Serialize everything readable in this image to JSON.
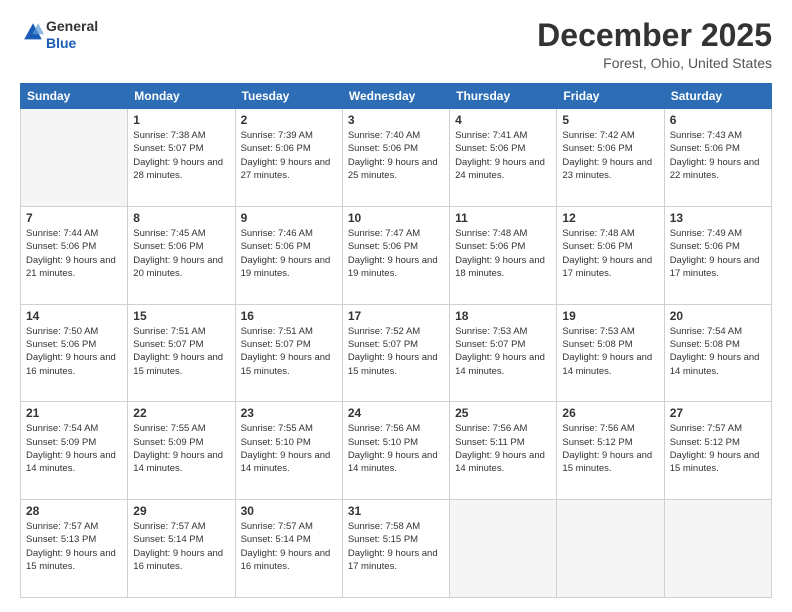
{
  "header": {
    "logo_general": "General",
    "logo_blue": "Blue",
    "month_title": "December 2025",
    "location": "Forest, Ohio, United States"
  },
  "weekdays": [
    "Sunday",
    "Monday",
    "Tuesday",
    "Wednesday",
    "Thursday",
    "Friday",
    "Saturday"
  ],
  "weeks": [
    [
      {
        "day": "",
        "empty": true
      },
      {
        "day": "1",
        "sunrise": "7:38 AM",
        "sunset": "5:07 PM",
        "daylight": "9 hours and 28 minutes."
      },
      {
        "day": "2",
        "sunrise": "7:39 AM",
        "sunset": "5:06 PM",
        "daylight": "9 hours and 27 minutes."
      },
      {
        "day": "3",
        "sunrise": "7:40 AM",
        "sunset": "5:06 PM",
        "daylight": "9 hours and 25 minutes."
      },
      {
        "day": "4",
        "sunrise": "7:41 AM",
        "sunset": "5:06 PM",
        "daylight": "9 hours and 24 minutes."
      },
      {
        "day": "5",
        "sunrise": "7:42 AM",
        "sunset": "5:06 PM",
        "daylight": "9 hours and 23 minutes."
      },
      {
        "day": "6",
        "sunrise": "7:43 AM",
        "sunset": "5:06 PM",
        "daylight": "9 hours and 22 minutes."
      }
    ],
    [
      {
        "day": "7",
        "sunrise": "7:44 AM",
        "sunset": "5:06 PM",
        "daylight": "9 hours and 21 minutes."
      },
      {
        "day": "8",
        "sunrise": "7:45 AM",
        "sunset": "5:06 PM",
        "daylight": "9 hours and 20 minutes."
      },
      {
        "day": "9",
        "sunrise": "7:46 AM",
        "sunset": "5:06 PM",
        "daylight": "9 hours and 19 minutes."
      },
      {
        "day": "10",
        "sunrise": "7:47 AM",
        "sunset": "5:06 PM",
        "daylight": "9 hours and 19 minutes."
      },
      {
        "day": "11",
        "sunrise": "7:48 AM",
        "sunset": "5:06 PM",
        "daylight": "9 hours and 18 minutes."
      },
      {
        "day": "12",
        "sunrise": "7:48 AM",
        "sunset": "5:06 PM",
        "daylight": "9 hours and 17 minutes."
      },
      {
        "day": "13",
        "sunrise": "7:49 AM",
        "sunset": "5:06 PM",
        "daylight": "9 hours and 17 minutes."
      }
    ],
    [
      {
        "day": "14",
        "sunrise": "7:50 AM",
        "sunset": "5:06 PM",
        "daylight": "9 hours and 16 minutes."
      },
      {
        "day": "15",
        "sunrise": "7:51 AM",
        "sunset": "5:07 PM",
        "daylight": "9 hours and 15 minutes."
      },
      {
        "day": "16",
        "sunrise": "7:51 AM",
        "sunset": "5:07 PM",
        "daylight": "9 hours and 15 minutes."
      },
      {
        "day": "17",
        "sunrise": "7:52 AM",
        "sunset": "5:07 PM",
        "daylight": "9 hours and 15 minutes."
      },
      {
        "day": "18",
        "sunrise": "7:53 AM",
        "sunset": "5:07 PM",
        "daylight": "9 hours and 14 minutes."
      },
      {
        "day": "19",
        "sunrise": "7:53 AM",
        "sunset": "5:08 PM",
        "daylight": "9 hours and 14 minutes."
      },
      {
        "day": "20",
        "sunrise": "7:54 AM",
        "sunset": "5:08 PM",
        "daylight": "9 hours and 14 minutes."
      }
    ],
    [
      {
        "day": "21",
        "sunrise": "7:54 AM",
        "sunset": "5:09 PM",
        "daylight": "9 hours and 14 minutes."
      },
      {
        "day": "22",
        "sunrise": "7:55 AM",
        "sunset": "5:09 PM",
        "daylight": "9 hours and 14 minutes."
      },
      {
        "day": "23",
        "sunrise": "7:55 AM",
        "sunset": "5:10 PM",
        "daylight": "9 hours and 14 minutes."
      },
      {
        "day": "24",
        "sunrise": "7:56 AM",
        "sunset": "5:10 PM",
        "daylight": "9 hours and 14 minutes."
      },
      {
        "day": "25",
        "sunrise": "7:56 AM",
        "sunset": "5:11 PM",
        "daylight": "9 hours and 14 minutes."
      },
      {
        "day": "26",
        "sunrise": "7:56 AM",
        "sunset": "5:12 PM",
        "daylight": "9 hours and 15 minutes."
      },
      {
        "day": "27",
        "sunrise": "7:57 AM",
        "sunset": "5:12 PM",
        "daylight": "9 hours and 15 minutes."
      }
    ],
    [
      {
        "day": "28",
        "sunrise": "7:57 AM",
        "sunset": "5:13 PM",
        "daylight": "9 hours and 15 minutes."
      },
      {
        "day": "29",
        "sunrise": "7:57 AM",
        "sunset": "5:14 PM",
        "daylight": "9 hours and 16 minutes."
      },
      {
        "day": "30",
        "sunrise": "7:57 AM",
        "sunset": "5:14 PM",
        "daylight": "9 hours and 16 minutes."
      },
      {
        "day": "31",
        "sunrise": "7:58 AM",
        "sunset": "5:15 PM",
        "daylight": "9 hours and 17 minutes."
      },
      {
        "day": "",
        "empty": true
      },
      {
        "day": "",
        "empty": true
      },
      {
        "day": "",
        "empty": true
      }
    ]
  ]
}
